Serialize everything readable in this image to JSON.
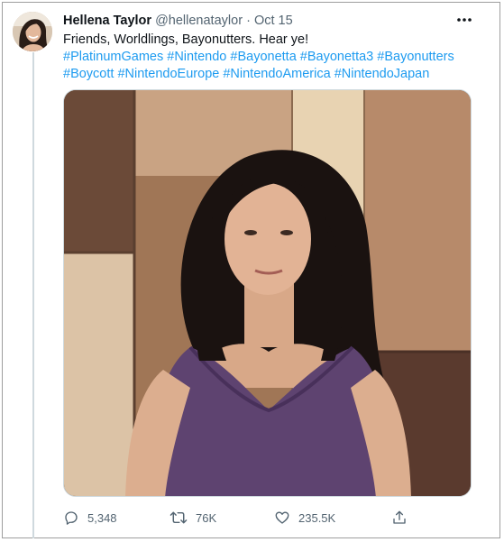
{
  "tweet": {
    "display_name": "Hellena Taylor",
    "handle": "@hellenataylor",
    "separator": "·",
    "date": "Oct 15",
    "text": "Friends, Worldlings, Bayonutters. Hear ye!",
    "hashtags_line1": [
      "#PlatinumGames",
      "#Nintendo",
      "#Bayonetta",
      "#Bayonetta3",
      "#Bayonutters"
    ],
    "hashtags_line2": [
      "#Boycott",
      "#NintendoEurope",
      "#NintendoAmerica",
      "#NintendoJapan"
    ]
  },
  "actions": {
    "replies": "5,348",
    "retweets": "76K",
    "likes": "235.5K"
  },
  "icons": {
    "more": "more-horizontal-icon",
    "reply": "reply-icon",
    "retweet": "retweet-icon",
    "like": "heart-icon",
    "share": "share-icon"
  },
  "colors": {
    "link": "#1d9bf0",
    "secondary_text": "#536471",
    "primary_text": "#0f1419"
  }
}
